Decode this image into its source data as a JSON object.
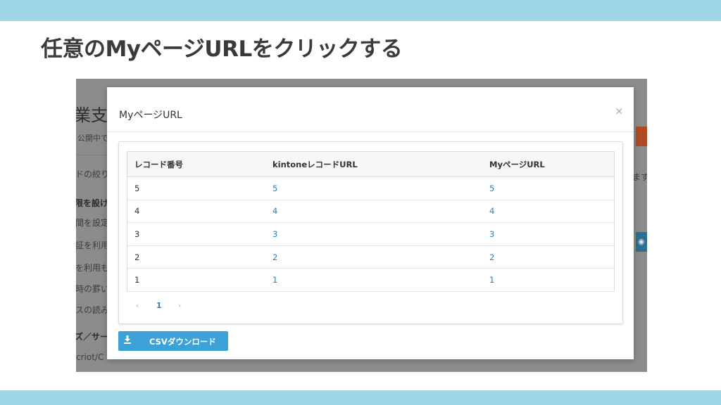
{
  "slide": {
    "title": "任意のMyページURLをクリックする"
  },
  "background_page": {
    "title_fragment": "業支",
    "fragments": [
      "公開中で",
      "ドの絞り",
      "限を設け",
      "間を設定",
      "証を利用",
      "を利用も",
      "時の罫い",
      "スの読み",
      "ズ／サー",
      "criot/C",
      "ます"
    ]
  },
  "modal": {
    "title": "MyページURL",
    "close_icon": "×",
    "table": {
      "columns": [
        "レコード番号",
        "kintoneレコードURL",
        "MyページURL"
      ],
      "rows": [
        {
          "record_no": "5",
          "kintone_url": "5",
          "mypage_url": "5"
        },
        {
          "record_no": "4",
          "kintone_url": "4",
          "mypage_url": "4"
        },
        {
          "record_no": "3",
          "kintone_url": "3",
          "mypage_url": "3"
        },
        {
          "record_no": "2",
          "kintone_url": "2",
          "mypage_url": "2"
        },
        {
          "record_no": "1",
          "kintone_url": "1",
          "mypage_url": "1"
        }
      ]
    },
    "pagination": {
      "prev": "‹",
      "current": "1",
      "next": "›"
    },
    "csv_button": {
      "icon": "download-icon",
      "label": "CSVダウンロード"
    }
  },
  "colors": {
    "accent_band": "#9fd7e6",
    "link": "#2e7cc0",
    "button": "#3ca1d6"
  }
}
